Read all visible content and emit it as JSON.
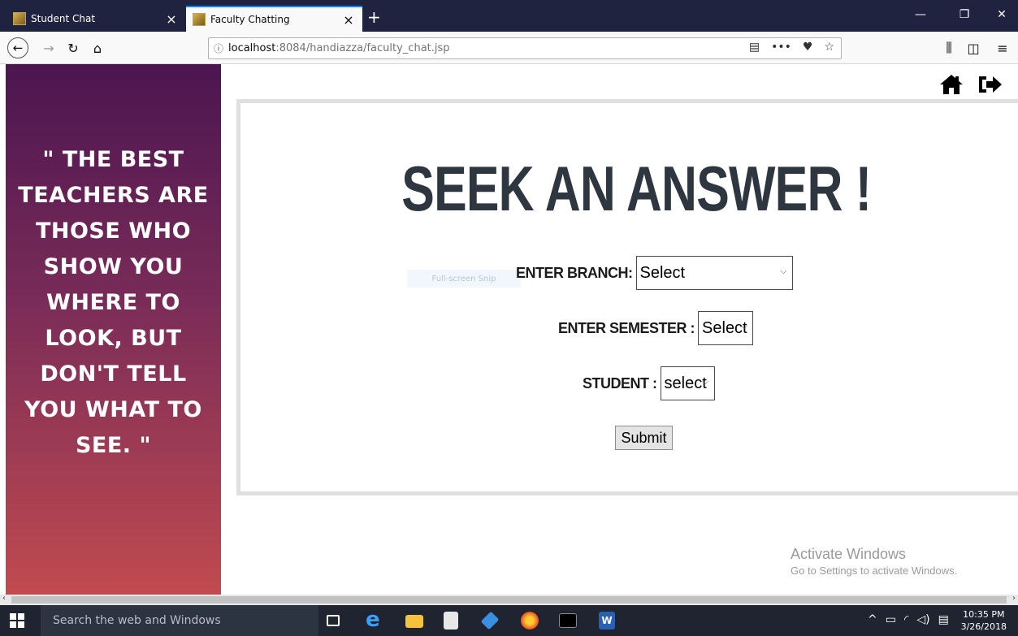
{
  "browser": {
    "tabs": [
      {
        "title": "Student Chat",
        "active": false
      },
      {
        "title": "Faculty Chatting",
        "active": true
      }
    ],
    "url_host": "localhost",
    "url_path": ":8084/handiazza/faculty_chat.jsp"
  },
  "sidebar": {
    "quote": "\" THE BEST TEACHERS ARE THOSE WHO SHOW YOU WHERE TO LOOK, BUT DON'T TELL YOU WHAT TO SEE. \""
  },
  "main": {
    "heading": "SEEK AN ANSWER !",
    "branch_label": "ENTER BRANCH:",
    "branch_value": "Select",
    "semester_label": "ENTER SEMESTER :",
    "semester_value": "Select",
    "student_label": "STUDENT :",
    "student_value": "select",
    "submit_label": "Submit",
    "snip_text": "Full-screen Snip"
  },
  "watermark": {
    "line1": "Activate Windows",
    "line2": "Go to Settings to activate Windows."
  },
  "taskbar": {
    "search_placeholder": "Search the web and Windows",
    "time": "10:35 PM",
    "date": "3/26/2018"
  },
  "colors": {
    "panel_top": "#4b1550",
    "panel_bottom": "#c14a4f",
    "heading": "#2e3640"
  }
}
